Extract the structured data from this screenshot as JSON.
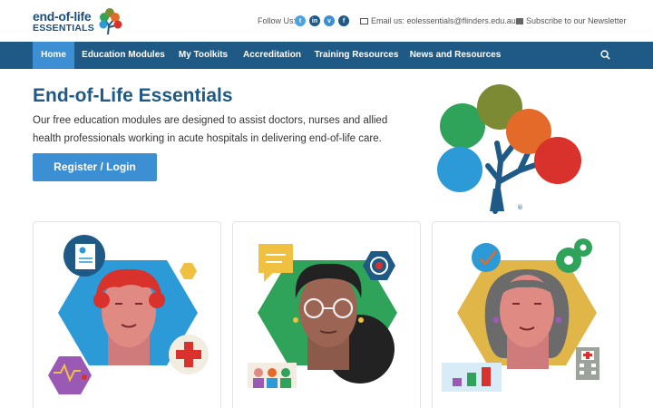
{
  "header": {
    "logo_line1": "end-of-life",
    "logo_line2": "ESSENTIALS",
    "follow_label": "Follow Us:",
    "social": [
      {
        "name": "twitter",
        "glyph": "t",
        "color": "#4aa3df"
      },
      {
        "name": "linkedin",
        "glyph": "in",
        "color": "#1e5a85"
      },
      {
        "name": "vimeo",
        "glyph": "v",
        "color": "#3c8fd2"
      },
      {
        "name": "facebook",
        "glyph": "f",
        "color": "#1e5a85"
      }
    ],
    "email_text": "Email us:  eolessentials@flinders.edu.au",
    "newsletter_text": "Subscribe to our Newsletter"
  },
  "nav": {
    "items": [
      {
        "label": "Home",
        "active": true
      },
      {
        "label": "Education Modules",
        "active": false
      },
      {
        "label": "My Toolkits",
        "active": false
      },
      {
        "label": "Accreditation",
        "active": false
      },
      {
        "label": "Training Resources",
        "active": false
      },
      {
        "label": "News and Resources",
        "active": false
      }
    ],
    "search_icon": "search-icon"
  },
  "hero": {
    "title": "End-of-Life Essentials",
    "description": "Our free education modules are designed to assist doctors, nurses and allied health professionals working in acute hospitals in delivering end-of-life care.",
    "cta_label": "Register / Login"
  },
  "colors": {
    "brand_dark": "#1e5a85",
    "brand_light": "#3c8fd2",
    "tree_green": "#2fa35a",
    "tree_olive": "#7b8a33",
    "tree_orange": "#e46a2a",
    "tree_blue": "#2b9ad6",
    "tree_red": "#d9312b"
  }
}
